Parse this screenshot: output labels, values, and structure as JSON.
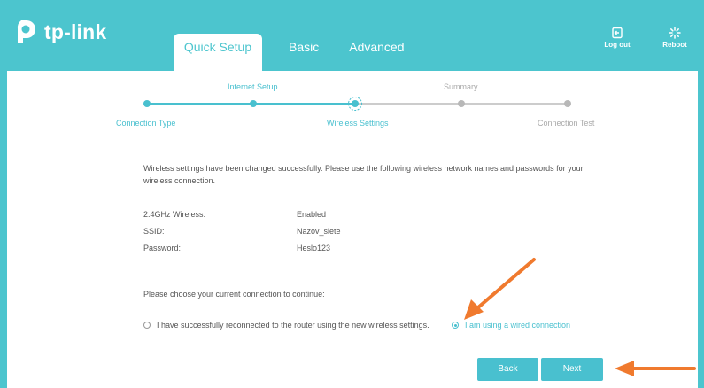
{
  "brand": {
    "name": "tp-link"
  },
  "tabs": [
    {
      "label": "Quick Setup",
      "active": true
    },
    {
      "label": "Basic",
      "active": false
    },
    {
      "label": "Advanced",
      "active": false
    }
  ],
  "header_buttons": {
    "logout": "Log out",
    "reboot": "Reboot"
  },
  "stepper": {
    "top_labels": [
      "Internet Setup",
      "Summary"
    ],
    "bottom_labels": [
      "Connection Type",
      "Wireless Settings",
      "Connection Test"
    ],
    "current_step": "Wireless Settings"
  },
  "message": "Wireless settings have been changed successfully. Please use the following wireless network names and passwords for your wireless connection.",
  "info": [
    {
      "label": "2.4GHz Wireless:",
      "value": "Enabled"
    },
    {
      "label": "SSID:",
      "value": "Nazov_siete"
    },
    {
      "label": "Password:",
      "value": "Heslo123"
    }
  ],
  "choose_text": "Please choose your current connection to continue:",
  "options": [
    {
      "label": "I have successfully reconnected to the router using the new wireless settings.",
      "selected": false
    },
    {
      "label": "I am using a wired connection",
      "selected": true
    }
  ],
  "buttons": {
    "back": "Back",
    "next": "Next"
  },
  "colors": {
    "accent": "#4cc5ce",
    "arrow": "#f07a2e",
    "inactive": "#cccccc"
  }
}
